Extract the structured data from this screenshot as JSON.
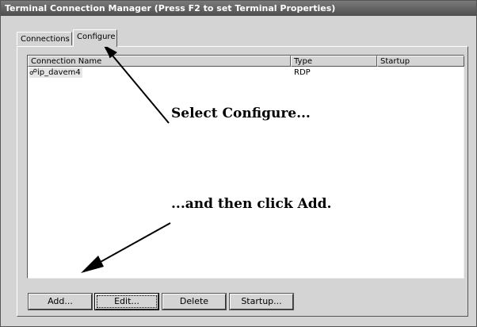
{
  "window": {
    "title": "Terminal Connection Manager (Press F2 to set Terminal Properties)"
  },
  "tabs": [
    {
      "label": "Connections",
      "selected": false
    },
    {
      "label": "Configure",
      "selected": true
    }
  ],
  "list": {
    "columns": [
      "Connection Name",
      "Type",
      "Startup"
    ],
    "rows": [
      {
        "name": "ip_davem4",
        "type": "RDP",
        "startup": "",
        "icon": "network-connection-icon"
      }
    ]
  },
  "buttons": {
    "add": "Add...",
    "edit": "Edit...",
    "delete": "Delete",
    "startup": "Startup..."
  },
  "annotations": {
    "select_configure": "Select Configure...",
    "click_add": "...and then click Add."
  },
  "colors": {
    "titlebar": "#5a5a5a",
    "face": "#d4d4d4"
  }
}
